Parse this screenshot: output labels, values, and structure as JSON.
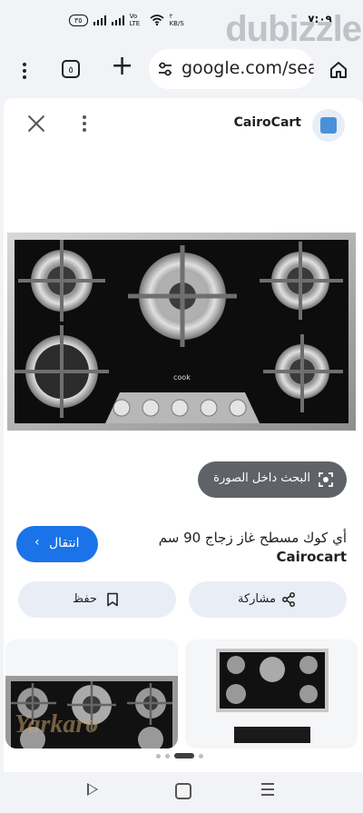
{
  "status_bar": {
    "time": "٧:٠٩",
    "battery": "٣٥",
    "network_label": "Vo LTE",
    "speed": "٢ KB/S"
  },
  "watermark": "dubizzle",
  "browser": {
    "url": "google.com/sear",
    "tab_count": "٥"
  },
  "panel": {
    "site_name": "CairoCart",
    "search_in_image": "البحث داخل الصورة",
    "visit_label": "انتقال",
    "product_title_line1": "أي كوك مسطح غاز زجاج 90 سم",
    "product_title_line2": "Cairocart",
    "share_label": "مشاركة",
    "save_label": "حفظ",
    "stove_brand": "cook",
    "related_watermark": "Yarkaro"
  },
  "colors": {
    "accent": "#1a73e8",
    "pill_dark": "#5f6368",
    "chip_bg": "#e9eef6"
  }
}
